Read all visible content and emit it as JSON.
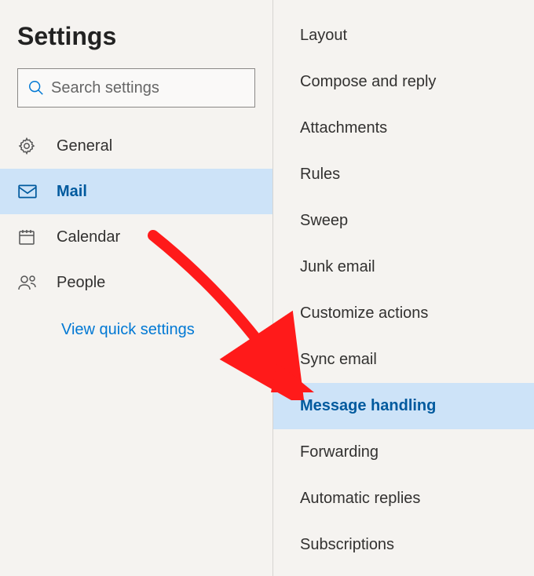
{
  "title": "Settings",
  "search": {
    "placeholder": "Search settings"
  },
  "sidebar": {
    "items": [
      {
        "label": "General",
        "selected": false
      },
      {
        "label": "Mail",
        "selected": true
      },
      {
        "label": "Calendar",
        "selected": false
      },
      {
        "label": "People",
        "selected": false
      }
    ],
    "quick_link": "View quick settings"
  },
  "subpanel": {
    "items": [
      {
        "label": "Layout",
        "selected": false
      },
      {
        "label": "Compose and reply",
        "selected": false
      },
      {
        "label": "Attachments",
        "selected": false
      },
      {
        "label": "Rules",
        "selected": false
      },
      {
        "label": "Sweep",
        "selected": false
      },
      {
        "label": "Junk email",
        "selected": false
      },
      {
        "label": "Customize actions",
        "selected": false
      },
      {
        "label": "Sync email",
        "selected": false
      },
      {
        "label": "Message handling",
        "selected": true
      },
      {
        "label": "Forwarding",
        "selected": false
      },
      {
        "label": "Automatic replies",
        "selected": false
      },
      {
        "label": "Subscriptions",
        "selected": false
      }
    ]
  }
}
